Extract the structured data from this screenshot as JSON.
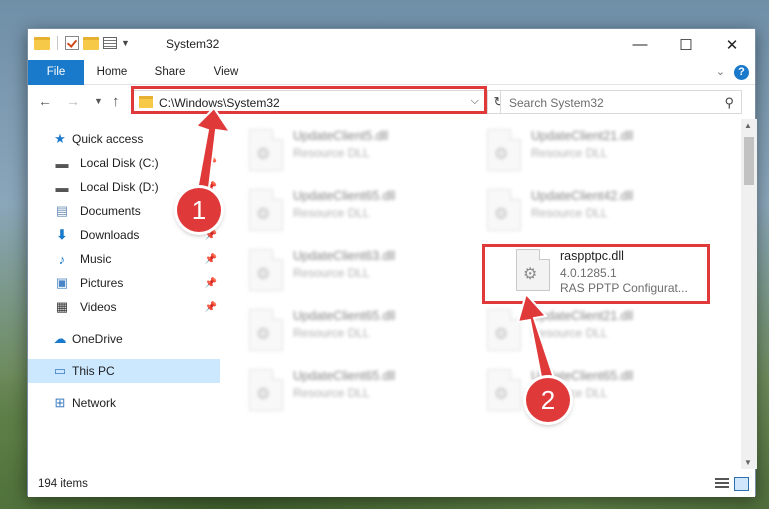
{
  "window": {
    "title": "System32"
  },
  "window_controls": {
    "minimize": "—",
    "maximize": "☐",
    "close": "✕"
  },
  "ribbon": {
    "file": "File",
    "home": "Home",
    "share": "Share",
    "view": "View"
  },
  "address": {
    "path": "C:\\Windows\\System32"
  },
  "search": {
    "placeholder": "Search System32"
  },
  "sidebar": {
    "quick_access": "Quick access",
    "local_c": "Local Disk (C:)",
    "local_d": "Local Disk (D:)",
    "documents": "Documents",
    "downloads": "Downloads",
    "music": "Music",
    "pictures": "Pictures",
    "videos": "Videos",
    "onedrive": "OneDrive",
    "this_pc": "This PC",
    "network": "Network"
  },
  "files": [
    {
      "name": "UpdateClient5.dll",
      "sub1": "Resource DLL",
      "sub2": ""
    },
    {
      "name": "UpdateClient21.dll",
      "sub1": "Resource DLL",
      "sub2": ""
    },
    {
      "name": "UpdateClient65.dll",
      "sub1": "Resource DLL",
      "sub2": ""
    },
    {
      "name": "UpdateClient42.dll",
      "sub1": "Resource DLL",
      "sub2": ""
    },
    {
      "name": "UpdateClient63.dll",
      "sub1": "Resource DLL",
      "sub2": ""
    },
    {
      "name": "raspptpc.dll",
      "sub1": "4.0.1285.1",
      "sub2": "RAS PPTP Configurat..."
    },
    {
      "name": "UpdateClient65.dll",
      "sub1": "Resource DLL",
      "sub2": ""
    },
    {
      "name": "UpdateClient21.dll",
      "sub1": "Resource DLL",
      "sub2": ""
    },
    {
      "name": "UpdateClient65.dll",
      "sub1": "Resource DLL",
      "sub2": ""
    },
    {
      "name": "UpdateClient65.dll",
      "sub1": "Resource DLL",
      "sub2": ""
    }
  ],
  "status": {
    "items": "194 items"
  },
  "annotations": {
    "step1": "1",
    "step2": "2",
    "accent_color": "#e0393a"
  }
}
